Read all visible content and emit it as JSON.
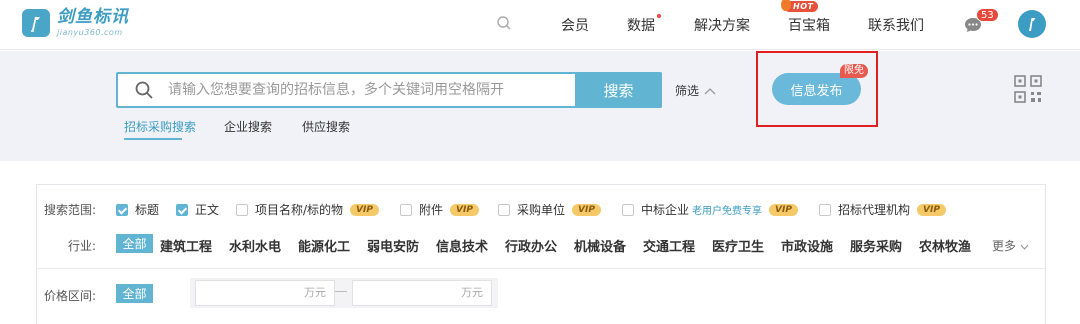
{
  "header": {
    "logo_name": "剑鱼标讯",
    "logo_domain": "jianyu360.com",
    "nav": [
      "会员",
      "数据",
      "解决方案",
      "百宝箱",
      "联系我们"
    ],
    "hot_badge": "HOT",
    "message_count": "53"
  },
  "search": {
    "placeholder": "请输入您想要查询的招标信息，多个关键词用空格隔开",
    "button": "搜索",
    "filter_label": "筛选",
    "tabs": [
      "招标采购搜索",
      "企业搜索",
      "供应搜索"
    ],
    "publish_button": "信息发布",
    "free_badge": "限免"
  },
  "filters": {
    "scope_label": "搜索范围:",
    "scope_options": [
      {
        "label": "标题",
        "checked": true
      },
      {
        "label": "正文",
        "checked": true
      },
      {
        "label": "项目名称/标的物",
        "checked": false,
        "vip": "VIP"
      },
      {
        "label": "附件",
        "checked": false,
        "vip": "VIP"
      },
      {
        "label": "采购单位",
        "checked": false,
        "vip": "VIP"
      },
      {
        "label": "中标企业",
        "checked": false,
        "promo": "老用户免费专享",
        "vip": "VIP"
      },
      {
        "label": "招标代理机构",
        "checked": false,
        "vip": "VIP"
      }
    ],
    "industry_label": "行业:",
    "industry_all": "全部",
    "industries": [
      "建筑工程",
      "水利水电",
      "能源化工",
      "弱电安防",
      "信息技术",
      "行政办公",
      "机械设备",
      "交通工程",
      "医疗卫生",
      "市政设施",
      "服务采购",
      "农林牧渔"
    ],
    "more": "更多",
    "price_label": "价格区间:",
    "price_all": "全部",
    "price_unit_min": "万元",
    "price_unit_max": "万元"
  },
  "colors": {
    "accent": "#61b5d3",
    "brand": "#3b9dc3",
    "hot": "#e8503a",
    "highlight_box": "#e02020",
    "vip": "#f5c968"
  }
}
